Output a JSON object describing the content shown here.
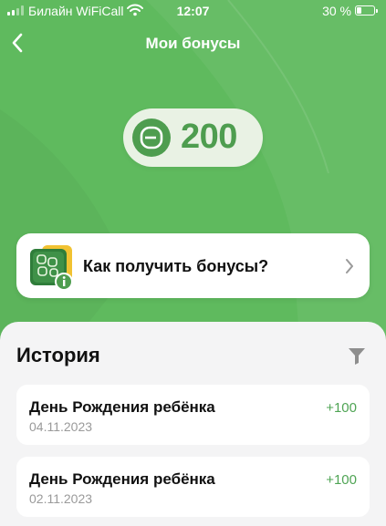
{
  "status_bar": {
    "carrier": "Билайн WiFiCall",
    "time": "12:07",
    "battery": "30 %",
    "battery_level": 0.3,
    "icons": [
      "signal-icon",
      "wifi-icon",
      "battery-icon"
    ]
  },
  "nav": {
    "title": "Мои бонусы",
    "back_icon": "chevron-left-icon"
  },
  "balance": {
    "value": "200",
    "icon": "bonus-b-icon"
  },
  "info_card": {
    "label": "Как получить бонусы?",
    "icon": "bonus-guide-icon",
    "chevron_icon": "chevron-right-icon"
  },
  "history": {
    "title": "История",
    "filter_icon": "filter-icon",
    "items": [
      {
        "title": "День Рождения ребёнка",
        "date": "04.11.2023",
        "amount": "+100"
      },
      {
        "title": "День Рождения ребёнка",
        "date": "02.11.2023",
        "amount": "+100"
      }
    ]
  },
  "colors": {
    "background": "#5fba5e",
    "accent": "#4e9d4f",
    "amount": "#4fa454",
    "sheet": "#f4f4f5"
  }
}
